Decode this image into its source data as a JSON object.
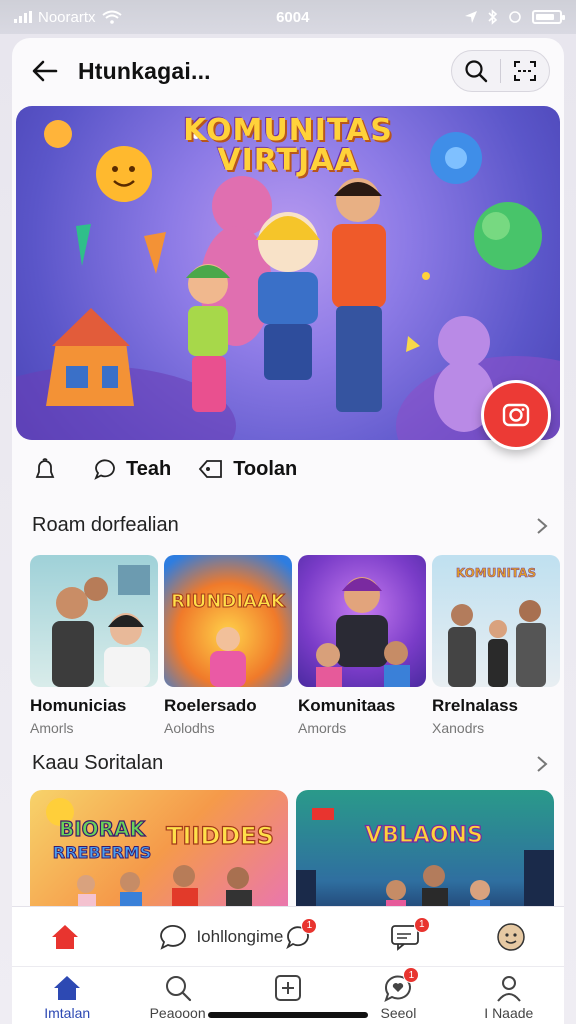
{
  "status_bar": {
    "carrier": "Noorartx",
    "time": "6004"
  },
  "header": {
    "title": "Htunkagai..."
  },
  "hero": {
    "line1": "KOMUNITAS",
    "line2": "VIRTJAA"
  },
  "actions": [
    {
      "label": ""
    },
    {
      "label": "Teah"
    },
    {
      "label": "Toolan"
    }
  ],
  "section1": {
    "title": "Roam dorfealian",
    "cards": [
      {
        "name": "Homunicias",
        "sub": "Amorls"
      },
      {
        "name": "Roelersado",
        "sub": "Aolodhs"
      },
      {
        "name": "Komunitaas",
        "sub": "Amords"
      },
      {
        "name": "Rrelnalass",
        "sub": "Xanodrs"
      }
    ]
  },
  "section2": {
    "title": "Kaau Soritalan",
    "cards": [
      {
        "art_line1": "BIORAK",
        "art_line2": "RREBERMS",
        "art_line3": "TIIDDES"
      },
      {
        "art_line1": "VBLAONS"
      }
    ]
  },
  "tabrow": {
    "chat_label": "Iohllongime",
    "badge1": "1",
    "badge2": "1"
  },
  "bottom_nav": [
    {
      "label": "Imtalan",
      "active": true
    },
    {
      "label": "Peaooon"
    },
    {
      "label": ""
    },
    {
      "label": "Seeol",
      "badge": "1"
    },
    {
      "label": "I Naade"
    }
  ],
  "colors": {
    "accent": "#ec3a35",
    "nav_active": "#2d49b3",
    "hero_bg": "#8d7be6",
    "title_yellow": "#ffd23a"
  }
}
